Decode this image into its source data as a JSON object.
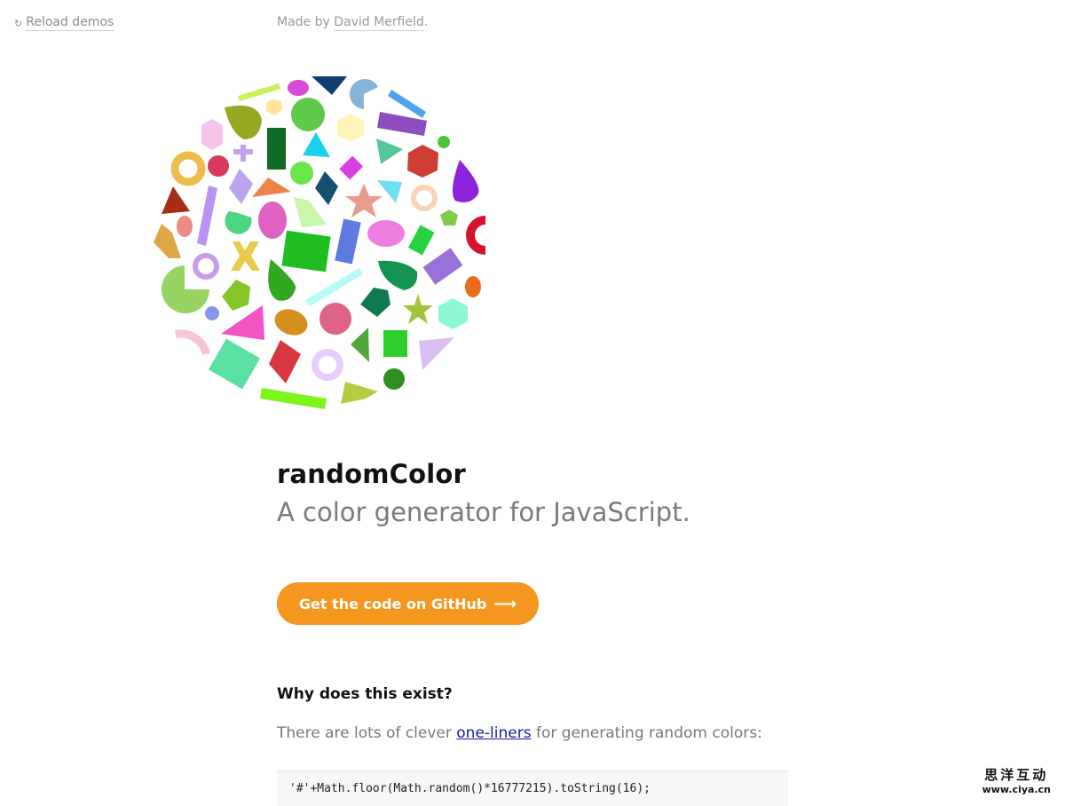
{
  "header": {
    "reload_icon": "reload-icon",
    "reload_glyph": "↻",
    "reload_label": "Reload demos",
    "credit_prefix": "Made by ",
    "credit_name": "David Merfield",
    "credit_suffix": "."
  },
  "hero": {
    "title": "randomColor",
    "subtitle": "A color generator for JavaScript.",
    "cta_label": "Get the code on GitHub",
    "cta_arrow": "⟶",
    "cta_color": "#f5961f"
  },
  "section": {
    "heading": "Why does this exist?",
    "text_before": "There are lots of clever ",
    "link": "one-liners",
    "text_after": " for generating random colors:",
    "code": "'#'+Math.floor(Math.random()*16777215).toString(16);"
  },
  "watermark": {
    "line1": "思洋互动",
    "line2": "www.ciya.cn"
  },
  "colors": {
    "background": "#ffffff",
    "link": "#1a1aa6",
    "muted": "#8c8c8c"
  }
}
